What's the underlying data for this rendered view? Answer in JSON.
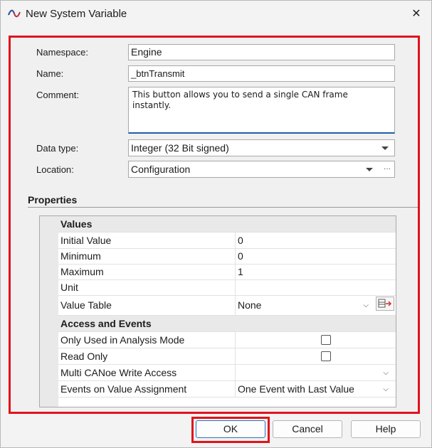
{
  "window": {
    "title": "New System Variable",
    "close_glyph": "✕"
  },
  "form": {
    "namespace_label": "Namespace:",
    "namespace_value": "Engine",
    "name_label": "Name:",
    "name_value": "_btnTransmit",
    "comment_label": "Comment:",
    "comment_value": "This button allows you to send a single CAN frame\ninstantly.",
    "datatype_label": "Data type:",
    "datatype_value": "Integer (32 Bit signed)",
    "location_label": "Location:",
    "location_value": "Configuration",
    "location_more": "···"
  },
  "properties": {
    "section_title": "Properties",
    "values_category": "Values",
    "initial_value_label": "Initial Value",
    "initial_value": "0",
    "minimum_label": "Minimum",
    "minimum_value": "0",
    "maximum_label": "Maximum",
    "maximum_value": "1",
    "unit_label": "Unit",
    "unit_value": "",
    "value_table_label": "Value Table",
    "value_table_value": "None",
    "access_category": "Access and Events",
    "analysis_mode_label": "Only Used in Analysis Mode",
    "analysis_mode_checked": false,
    "read_only_label": "Read Only",
    "read_only_checked": false,
    "multi_write_label": "Multi CANoe Write Access",
    "multi_write_value": "",
    "events_label": "Events on Value Assignment",
    "events_value": "One Event with Last Value"
  },
  "buttons": {
    "ok": "OK",
    "cancel": "Cancel",
    "help": "Help"
  },
  "colors": {
    "highlight": "#e0141c",
    "accent": "#1e5fa6"
  }
}
